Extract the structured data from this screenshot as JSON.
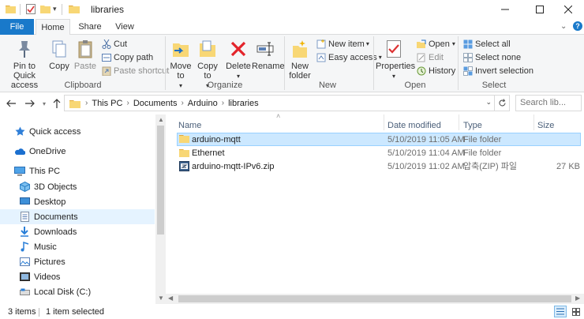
{
  "window": {
    "title": "libraries",
    "controls": [
      "minimize-icon",
      "maximize-icon",
      "close-icon"
    ]
  },
  "ribbon_tabs": [
    "File",
    "Home",
    "Share",
    "View"
  ],
  "ribbon": {
    "clipboard": {
      "label": "Clipboard",
      "pin_to_quick_access": "Pin to Quick access",
      "copy": "Copy",
      "paste": "Paste",
      "cut": "Cut",
      "copy_path": "Copy path",
      "paste_shortcut": "Paste shortcut"
    },
    "organize": {
      "label": "Organize",
      "move_to": "Move to",
      "copy_to": "Copy to",
      "delete": "Delete",
      "rename": "Rename"
    },
    "new": {
      "label": "New",
      "new_folder": "New folder",
      "new_item": "New item",
      "easy_access": "Easy access"
    },
    "open": {
      "label": "Open",
      "properties": "Properties",
      "open": "Open",
      "edit": "Edit",
      "history": "History"
    },
    "select": {
      "label": "Select",
      "select_all": "Select all",
      "select_none": "Select none",
      "invert_selection": "Invert selection"
    }
  },
  "address": {
    "breadcrumbs": [
      "This PC",
      "Documents",
      "Arduino",
      "libraries"
    ],
    "search_placeholder": "Search lib..."
  },
  "nav_pane": {
    "items": [
      {
        "label": "Quick access",
        "icon": "star-icon"
      },
      {
        "label": "OneDrive",
        "icon": "cloud-icon"
      },
      {
        "label": "This PC",
        "icon": "computer-icon"
      },
      {
        "label": "3D Objects",
        "icon": "cube-icon"
      },
      {
        "label": "Desktop",
        "icon": "desktop-icon"
      },
      {
        "label": "Documents",
        "icon": "document-icon"
      },
      {
        "label": "Downloads",
        "icon": "download-icon"
      },
      {
        "label": "Music",
        "icon": "music-icon"
      },
      {
        "label": "Pictures",
        "icon": "picture-icon"
      },
      {
        "label": "Videos",
        "icon": "video-icon"
      },
      {
        "label": "Local Disk (C:)",
        "icon": "disk-icon"
      }
    ]
  },
  "file_list": {
    "columns": [
      "Name",
      "Date modified",
      "Type",
      "Size"
    ],
    "rows": [
      {
        "name": "arduino-mqtt",
        "date": "5/10/2019 11:05 AM",
        "type": "File folder",
        "size": "",
        "icon": "folder-icon",
        "selected": true
      },
      {
        "name": "Ethernet",
        "date": "5/10/2019 11:04 AM",
        "type": "File folder",
        "size": "",
        "icon": "folder-icon",
        "selected": false
      },
      {
        "name": "arduino-mqtt-IPv6.zip",
        "date": "5/10/2019 11:02 AM",
        "type": "압축(ZIP) 파일",
        "size": "27 KB",
        "icon": "zip-icon",
        "selected": false
      }
    ]
  },
  "status_bar": {
    "item_count": "3 items",
    "selection": "1 item selected"
  },
  "colors": {
    "accent": "#1979ca",
    "selection": "#cce8ff",
    "selection_border": "#99d1ff",
    "folder": "#f8d775"
  }
}
